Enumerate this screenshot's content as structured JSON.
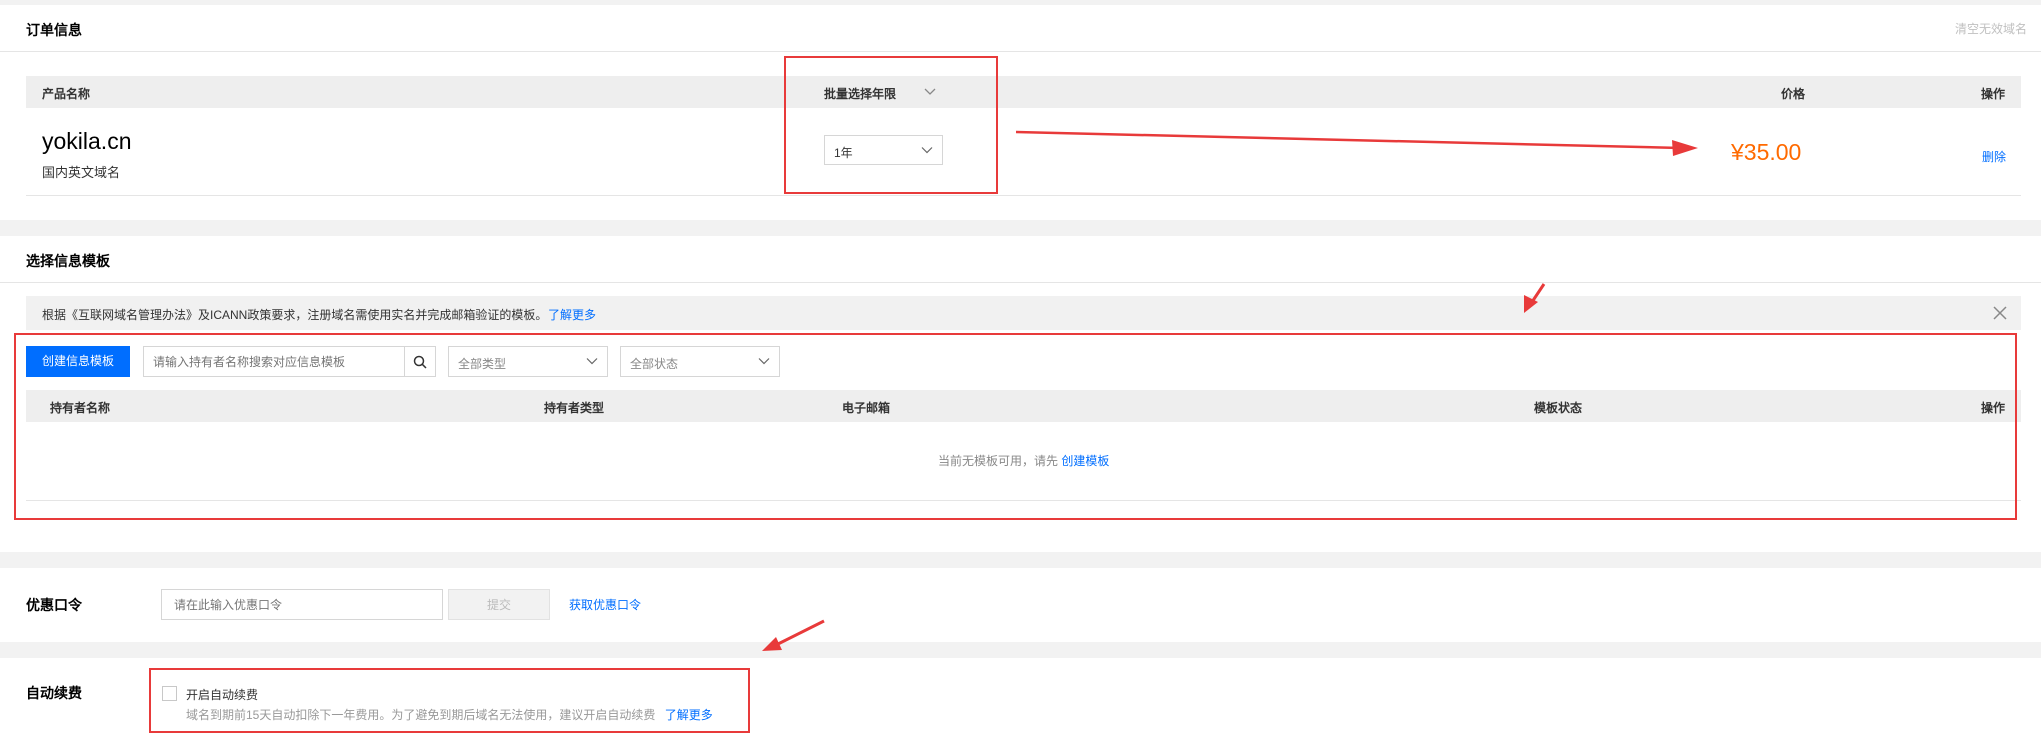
{
  "order": {
    "title": "订单信息",
    "clear_invalid": "清空无效域名",
    "headers": {
      "product": "产品名称",
      "batch_years": "批量选择年限",
      "price": "价格",
      "action": "操作"
    },
    "row": {
      "domain": "yokila.cn",
      "type": "国内英文域名",
      "years": "1年",
      "price": "¥35.00",
      "delete": "删除"
    }
  },
  "template": {
    "title": "选择信息模板",
    "notice": "根据《互联网域名管理办法》及ICANN政策要求，注册域名需使用实名并完成邮箱验证的模板。",
    "notice_link": "了解更多",
    "create_button": "创建信息模板",
    "search_placeholder": "请输入持有者名称搜索对应信息模板",
    "filter_type": "全部类型",
    "filter_status": "全部状态",
    "headers": {
      "holder_name": "持有者名称",
      "holder_type": "持有者类型",
      "email": "电子邮箱",
      "status": "模板状态",
      "action": "操作"
    },
    "empty_text": "当前无模板可用，请先",
    "empty_link": "创建模板"
  },
  "coupon": {
    "label": "优惠口令",
    "placeholder": "请在此输入优惠口令",
    "submit": "提交",
    "get_link": "获取优惠口令"
  },
  "renew": {
    "label": "自动续费",
    "checkbox_label": "开启自动续费",
    "checked": false,
    "desc": "域名到期前15天自动扣除下一年费用。为了避免到期后域名无法使用，建议开启自动续费",
    "learn_more": "了解更多"
  },
  "colors": {
    "accent": "#006eff",
    "price": "#ff6a00",
    "annotation": "#e83a3a",
    "primary_button": "#006eff"
  }
}
